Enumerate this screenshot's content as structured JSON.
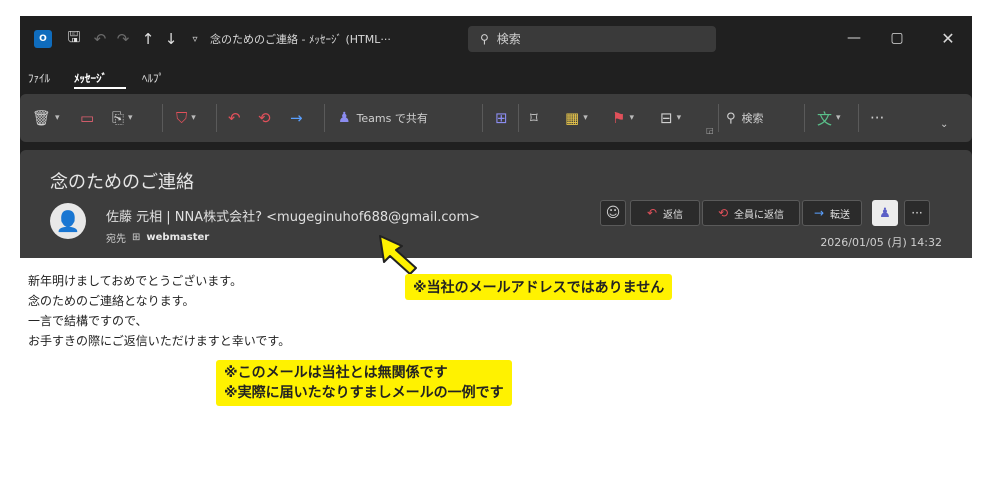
{
  "titlebar": {
    "app_icon": "O",
    "title": "念のためのご連絡 - ﾒｯｾｰｼﾞ (HTML···",
    "search_placeholder": "検索",
    "icons": [
      "outlook-app-icon",
      "save-icon",
      "undo-icon",
      "redo-icon",
      "up-arrow-icon",
      "down-arrow-icon",
      "quick-access-icon",
      "search-icon",
      "minimize-icon",
      "maximize-icon",
      "close-icon"
    ]
  },
  "menu": {
    "tabs": [
      {
        "label": "ﾌｧｲﾙ"
      },
      {
        "label": "ﾒｯｾｰｼﾞ"
      },
      {
        "label": "ﾍﾙﾌﾟ"
      }
    ]
  },
  "ribbon": {
    "teams_share_label": "Teams で共有",
    "search_label": "検索",
    "more_label": "···",
    "icons": [
      "trash-icon",
      "archive-icon",
      "move-icon",
      "report-icon",
      "reply-icon",
      "reply-all-icon",
      "forward-icon",
      "teams-icon",
      "apps-icon",
      "comment-icon",
      "categorize-icon",
      "flag-icon",
      "sort-icon",
      "search-icon",
      "translate-icon",
      "more-icon",
      "chevron-down-icon"
    ]
  },
  "message": {
    "subject": "念のためのご連絡",
    "sender": "佐藤 元相 | NNA株式会社? <mugeginuhof688@gmail.com>",
    "recipient_label": "宛先",
    "recipient_name": "webmaster",
    "timestamp": "2026/01/05 (月) 14:32",
    "actions": {
      "reply": "返信",
      "reply_all": "全員に返信",
      "forward": "転送",
      "more": "···"
    },
    "body_lines": [
      "新年明けましておめでとうございます。",
      "念のためのご連絡となります。",
      "一言で結構ですので、",
      "お手すきの際にご返信いただけますと幸いです。"
    ]
  },
  "annotations": {
    "not_our_address": "※当社のメールアドレスではありません",
    "unrelated_line1": "※このメールは当社とは無関係です",
    "unrelated_line2": "※実際に届いたなりすましメールの一例です",
    "highlight_color": "#fff200"
  },
  "colors": {
    "window_bg": "#202020",
    "panel_bg": "#3d3d3d",
    "reply_accent": "#e0505a",
    "forward_accent": "#5aa0ff",
    "teams_accent": "#5b5fc7"
  }
}
